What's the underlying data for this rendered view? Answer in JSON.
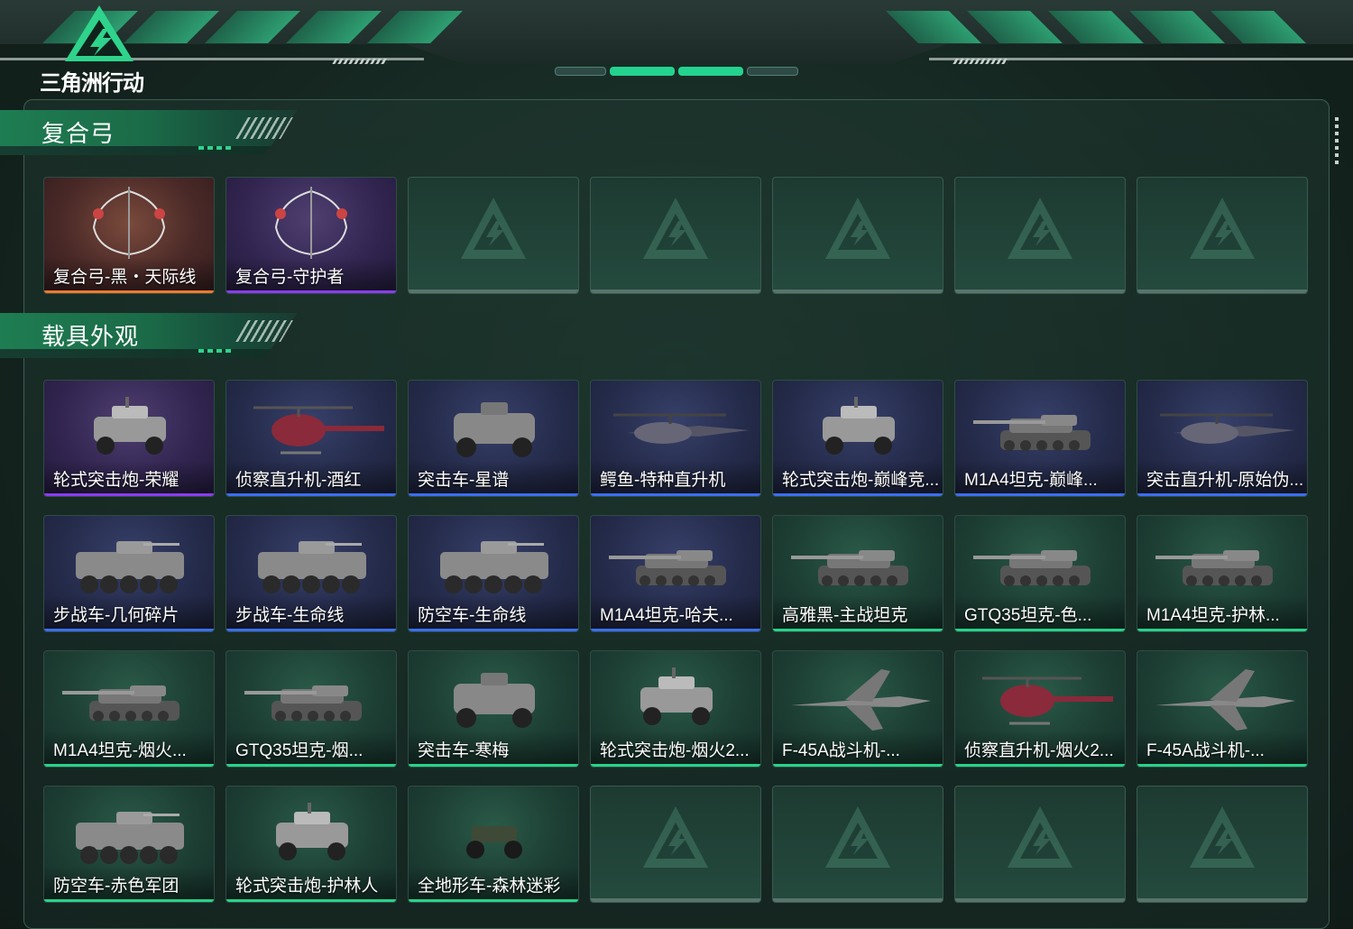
{
  "game_title": "三角洲行动",
  "sections": [
    {
      "title": "复合弓"
    },
    {
      "title": "载具外观"
    }
  ],
  "bow_items": [
    {
      "label": "复合弓-黑・天际线",
      "rarity": "orange",
      "icon": "compound-bow"
    },
    {
      "label": "复合弓-守护者",
      "rarity": "purple",
      "icon": "compound-bow"
    }
  ],
  "vehicle_items": [
    {
      "label": "轮式突击炮-荣耀",
      "rarity": "purple",
      "icon": "wheeled-assault-gun"
    },
    {
      "label": "侦察直升机-酒红",
      "rarity": "blue",
      "icon": "scout-helicopter"
    },
    {
      "label": "突击车-星谱",
      "rarity": "blue",
      "icon": "assault-vehicle"
    },
    {
      "label": "鳄鱼-特种直升机",
      "rarity": "blue",
      "icon": "attack-helicopter"
    },
    {
      "label": "轮式突击炮-巅峰竞...",
      "rarity": "blue",
      "icon": "wheeled-assault-gun"
    },
    {
      "label": "M1A4坦克-巅峰...",
      "rarity": "blue",
      "icon": "tank"
    },
    {
      "label": "突击直升机-原始伪...",
      "rarity": "blue",
      "icon": "attack-helicopter"
    },
    {
      "label": "步战车-几何碎片",
      "rarity": "blue",
      "icon": "ifv"
    },
    {
      "label": "步战车-生命线",
      "rarity": "blue",
      "icon": "ifv"
    },
    {
      "label": "防空车-生命线",
      "rarity": "blue",
      "icon": "ifv"
    },
    {
      "label": "M1A4坦克-哈夫...",
      "rarity": "blue",
      "icon": "tank"
    },
    {
      "label": "高雅黑-主战坦克",
      "rarity": "green",
      "icon": "tank"
    },
    {
      "label": "GTQ35坦克-色...",
      "rarity": "green",
      "icon": "tank"
    },
    {
      "label": "M1A4坦克-护林...",
      "rarity": "green",
      "icon": "tank"
    },
    {
      "label": "M1A4坦克-烟火...",
      "rarity": "green",
      "icon": "tank"
    },
    {
      "label": "GTQ35坦克-烟...",
      "rarity": "green",
      "icon": "tank"
    },
    {
      "label": "突击车-寒梅",
      "rarity": "green",
      "icon": "assault-vehicle"
    },
    {
      "label": "轮式突击炮-烟火2...",
      "rarity": "green",
      "icon": "wheeled-assault-gun"
    },
    {
      "label": "F-45A战斗机-...",
      "rarity": "green",
      "icon": "fighter-jet"
    },
    {
      "label": "侦察直升机-烟火2...",
      "rarity": "green",
      "icon": "scout-helicopter"
    },
    {
      "label": "F-45A战斗机-...",
      "rarity": "green",
      "icon": "fighter-jet"
    },
    {
      "label": "防空车-赤色军团",
      "rarity": "green",
      "icon": "ifv"
    },
    {
      "label": "轮式突击炮-护林人",
      "rarity": "green",
      "icon": "wheeled-assault-gun"
    },
    {
      "label": "全地形车-森林迷彩",
      "rarity": "green",
      "icon": "atv"
    }
  ],
  "colors": {
    "accent": "#27d38a",
    "rarity_orange": "#f07a2c",
    "rarity_purple": "#8a3cf0",
    "rarity_blue": "#3a6ff0",
    "rarity_green": "#27d38a"
  }
}
